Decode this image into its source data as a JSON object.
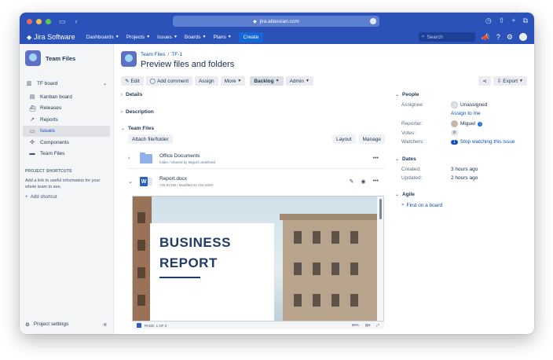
{
  "browser": {
    "url": "jira.atlassian.com"
  },
  "nav": {
    "brand": "Jira Software",
    "items": [
      "Dashboards",
      "Projects",
      "Issues",
      "Boards",
      "Plans"
    ],
    "create": "Create",
    "search_placeholder": "Search"
  },
  "sidebar": {
    "project": "Team Files",
    "board": "TF board",
    "items": [
      "Kanban board",
      "Releases",
      "Reports",
      "Issues",
      "Components",
      "Team Files"
    ],
    "active": "Issues",
    "shortcuts_title": "PROJECT SHORTCUTS",
    "shortcuts_text": "Add a link to useful information for your whole team to see.",
    "add_shortcut": "Add shortcut",
    "settings": "Project settings"
  },
  "issue": {
    "breadcrumb_project": "Team Files",
    "breadcrumb_key": "TF-1",
    "title": "Preview files and folders",
    "actions": {
      "edit": "Edit",
      "comment": "Add comment",
      "assign": "Assign",
      "more": "More",
      "status": "Backlog",
      "admin": "Admin"
    },
    "export": "Export",
    "sections": {
      "details": "Details",
      "description": "Description",
      "team_files": "Team Files"
    }
  },
  "files": {
    "attach": "Attach file/folder",
    "layout": "Layout",
    "manage": "Manage",
    "folder": {
      "name": "Office Documents",
      "meta": "folder / Shared by Miguel undefined"
    },
    "doc": {
      "name": "Report.docx",
      "meta": "725.63 KB / Modified 21-Oct-2020"
    },
    "preview": {
      "line1": "BUSINESS",
      "line2": "REPORT",
      "page": "PAGE: 1 OF 2",
      "zoom": "88%"
    }
  },
  "people": {
    "title": "People",
    "assignee_label": "Assignee:",
    "assignee": "Unassigned",
    "assign_me": "Assign to me",
    "reporter_label": "Reporter:",
    "reporter": "Miguel",
    "votes_label": "Votes:",
    "votes": "0",
    "watchers_label": "Watchers:",
    "watchers": "1",
    "stop_watching": "Stop watching this issue"
  },
  "dates": {
    "title": "Dates",
    "created_label": "Created:",
    "created": "3 hours ago",
    "updated_label": "Updated:",
    "updated": "2 hours ago"
  },
  "agile": {
    "title": "Agile",
    "link": "Find on a board"
  }
}
